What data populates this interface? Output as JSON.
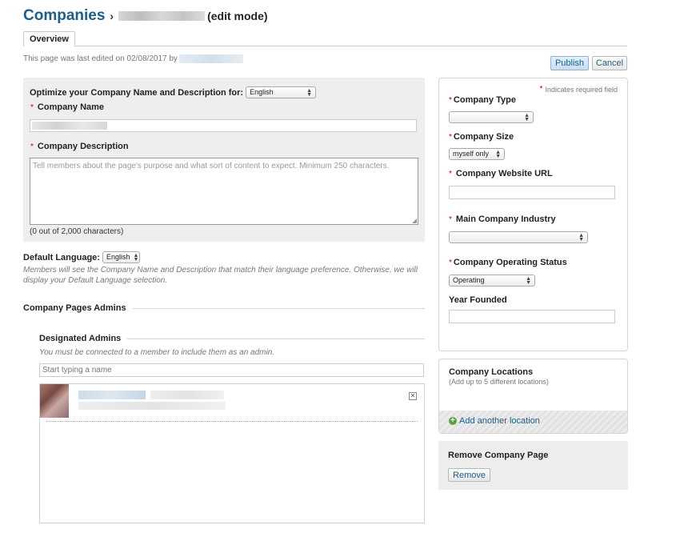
{
  "header": {
    "title": "Companies",
    "separator": "›",
    "mode": "(edit mode)"
  },
  "tabs": [
    {
      "label": "Overview"
    }
  ],
  "last_edited": "This page was last edited on 02/08/2017 by",
  "actions": {
    "publish": "Publish",
    "cancel": "Cancel"
  },
  "left": {
    "optimize_label": "Optimize your Company Name and Description for:",
    "optimize_value": "English",
    "company_name_label": "Company Name",
    "company_description_label": "Company Description",
    "description_placeholder": "Tell members about the page's purpose and what sort of content to expect. Minimum 250 characters.",
    "char_count": "(0 out of 2,000 characters)",
    "default_language_label": "Default Language:",
    "default_language_value": "English",
    "default_language_hint": "Members will see the Company Name and Description that match their language preference. Otherwise, we will display your Default Language selection."
  },
  "admins": {
    "section_title": "Company Pages Admins",
    "designated_title": "Designated Admins",
    "designated_hint": "You must be connected to a member to include them as an admin.",
    "search_placeholder": "Start typing a name"
  },
  "right": {
    "required_note": "Indicates required field",
    "company_type_label": "Company Type",
    "company_type_value": "",
    "company_size_label": "Company Size",
    "company_size_value": "myself only",
    "website_label": "Company Website URL",
    "industry_label": "Main Company Industry",
    "industry_value": "",
    "status_label": "Company Operating Status",
    "status_value": "Operating",
    "year_label": "Year Founded"
  },
  "locations": {
    "title": "Company Locations",
    "hint": "(Add up to 5 different locations)",
    "add_link": "Add another location"
  },
  "remove": {
    "title": "Remove Company Page",
    "button": "Remove"
  },
  "colors": {
    "link": "#1b5d8d",
    "required": "#c30000",
    "panel_gray": "#eeeeee",
    "add_icon": "#5aa33b"
  }
}
